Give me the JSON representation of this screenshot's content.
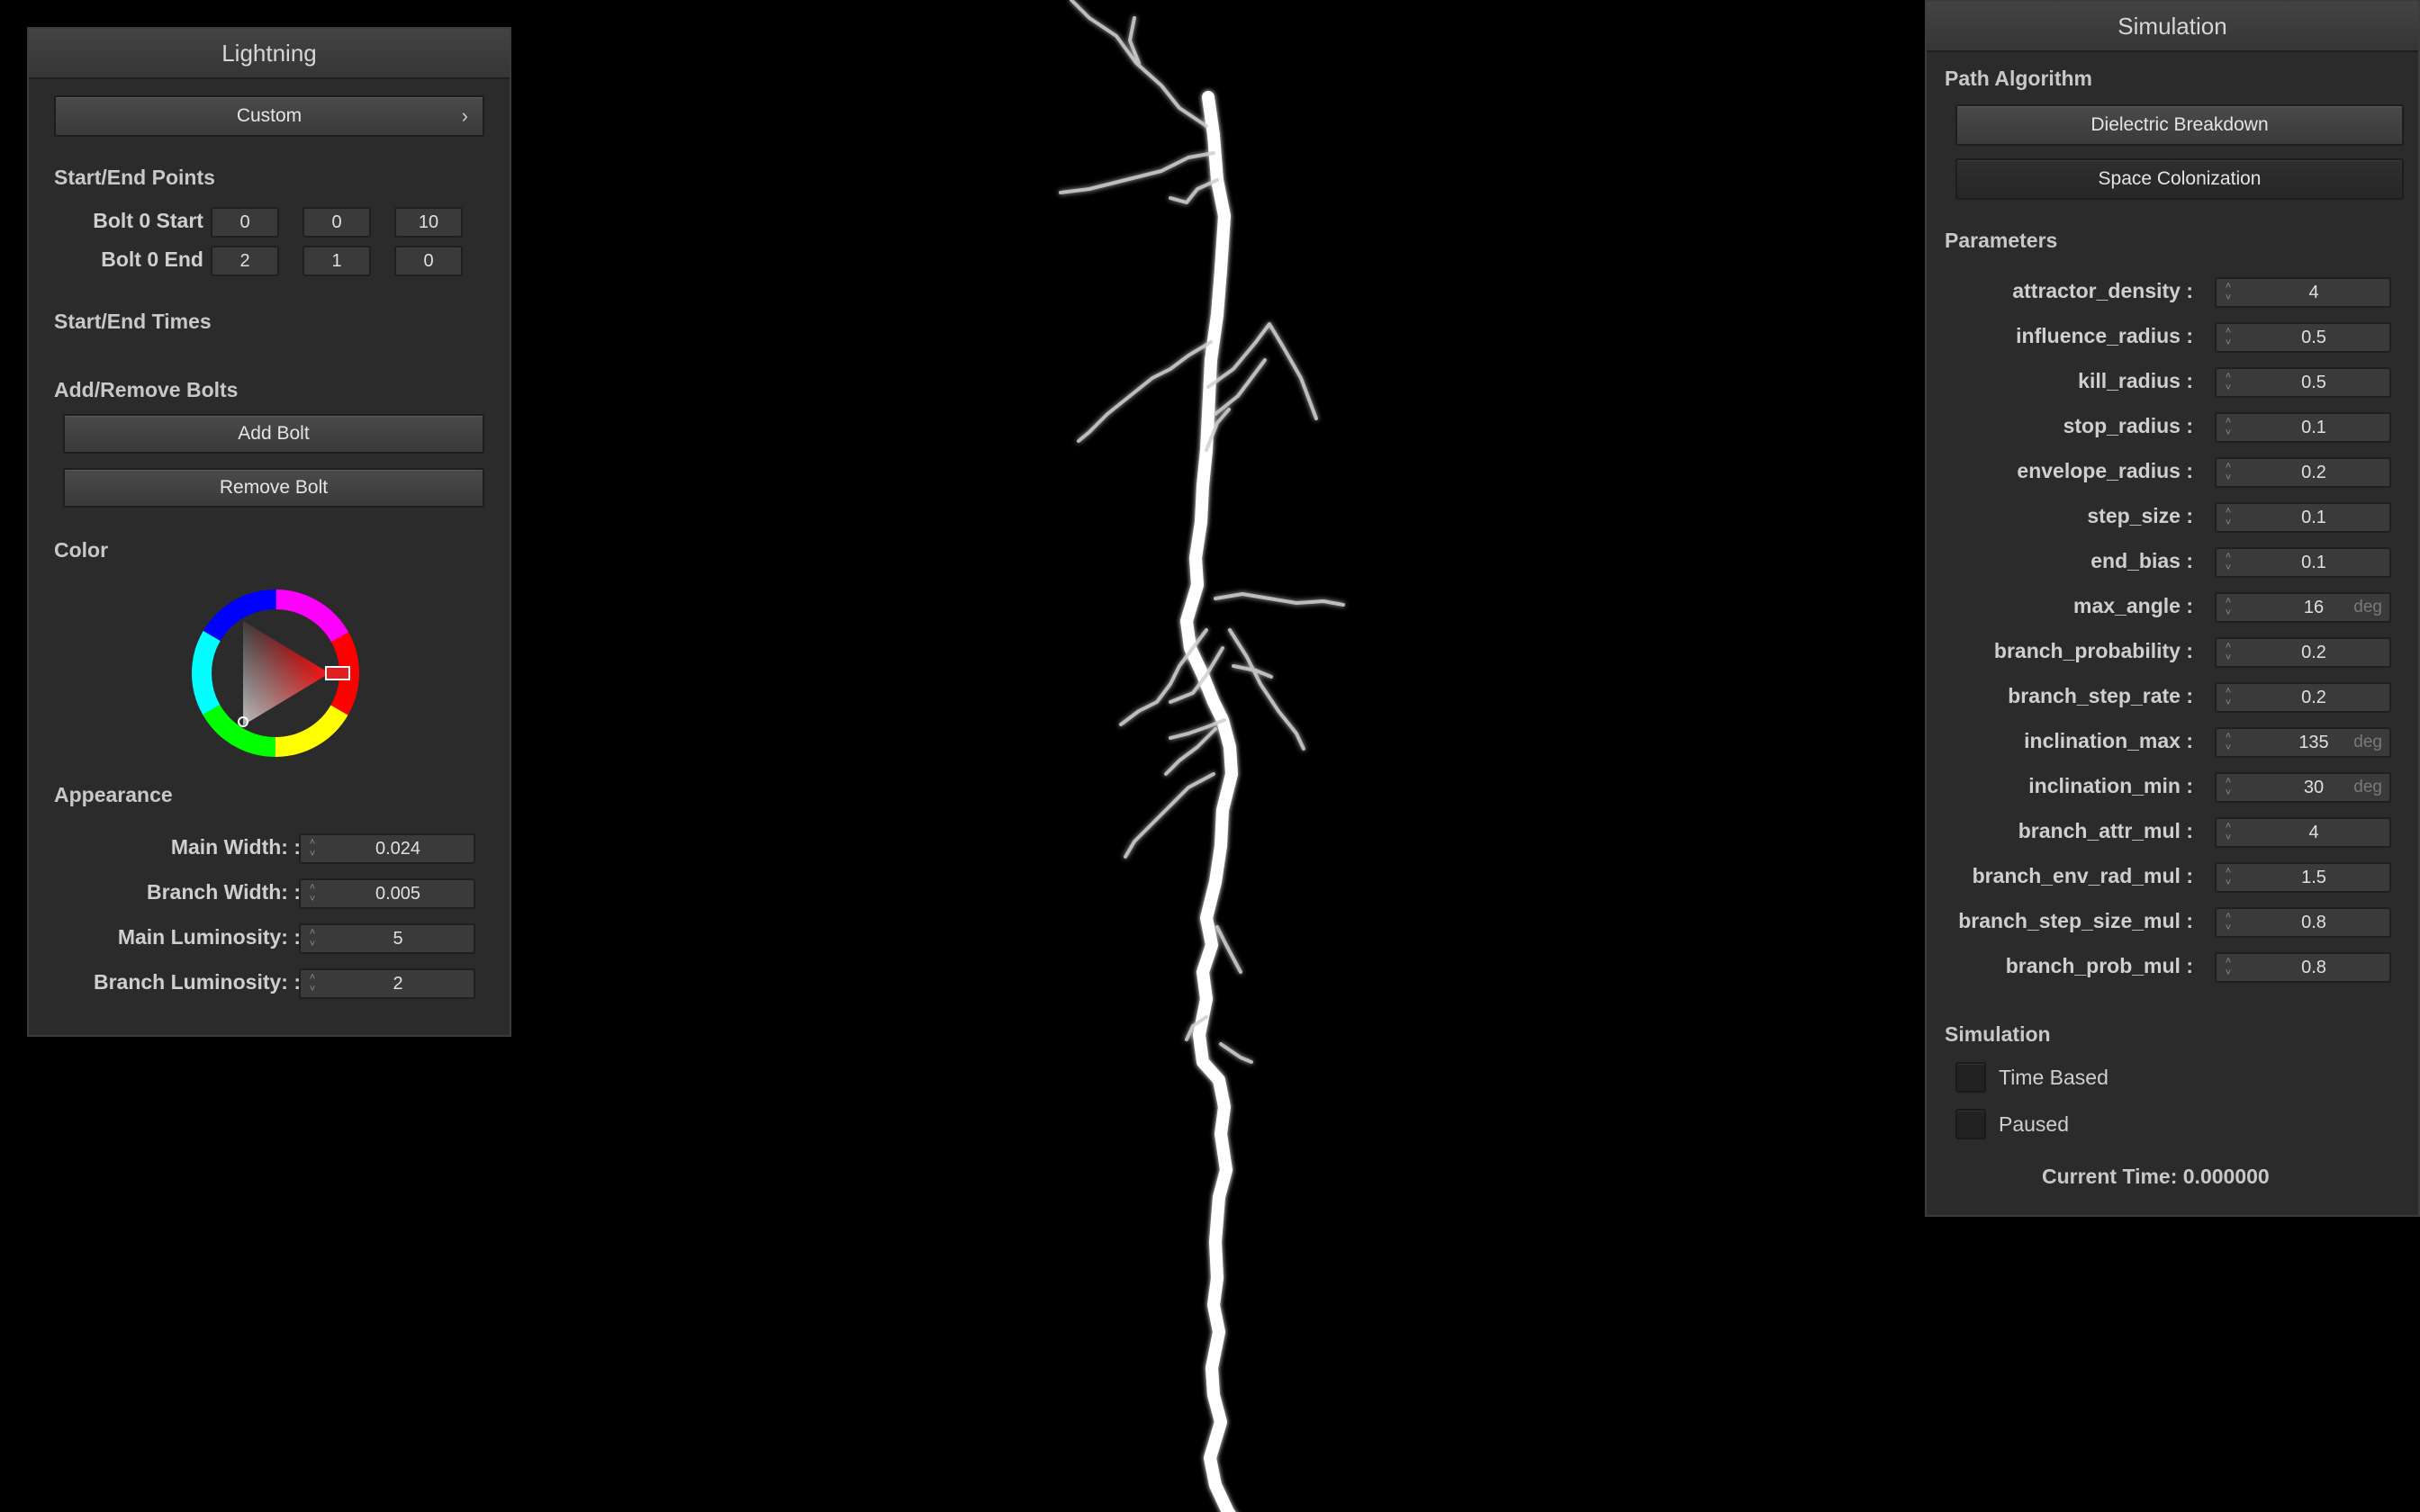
{
  "lightning_panel": {
    "title": "Lightning",
    "preset_button": "Custom",
    "preset_chevron": "›",
    "start_end_points": {
      "heading": "Start/End Points",
      "bolt_start_label": "Bolt 0 Start :",
      "bolt_start": [
        "0",
        "0",
        "10"
      ],
      "bolt_end_label": "Bolt 0 End :",
      "bolt_end": [
        "2",
        "1",
        "0"
      ]
    },
    "start_end_times": {
      "heading": "Start/End Times"
    },
    "add_remove": {
      "heading": "Add/Remove Bolts",
      "add_label": "Add Bolt",
      "remove_label": "Remove Bolt"
    },
    "color": {
      "heading": "Color",
      "selected_hue": "#ff0000"
    },
    "appearance": {
      "heading": "Appearance",
      "fields": [
        {
          "label": "Main Width: :",
          "value": "0.024"
        },
        {
          "label": "Branch Width: :",
          "value": "0.005"
        },
        {
          "label": "Main Luminosity: :",
          "value": "5"
        },
        {
          "label": "Branch Luminosity: :",
          "value": "2"
        }
      ]
    }
  },
  "simulation_panel": {
    "title": "Simulation",
    "path_algorithm": {
      "heading": "Path Algorithm",
      "options": [
        "Dielectric Breakdown",
        "Space Colonization"
      ]
    },
    "parameters": {
      "heading": "Parameters",
      "fields": [
        {
          "label": "attractor_density :",
          "value": "4",
          "unit": ""
        },
        {
          "label": "influence_radius :",
          "value": "0.5",
          "unit": ""
        },
        {
          "label": "kill_radius :",
          "value": "0.5",
          "unit": ""
        },
        {
          "label": "stop_radius :",
          "value": "0.1",
          "unit": ""
        },
        {
          "label": "envelope_radius :",
          "value": "0.2",
          "unit": ""
        },
        {
          "label": "step_size :",
          "value": "0.1",
          "unit": ""
        },
        {
          "label": "end_bias :",
          "value": "0.1",
          "unit": ""
        },
        {
          "label": "max_angle :",
          "value": "16",
          "unit": "deg"
        },
        {
          "label": "branch_probability :",
          "value": "0.2",
          "unit": ""
        },
        {
          "label": "branch_step_rate :",
          "value": "0.2",
          "unit": ""
        },
        {
          "label": "inclination_max :",
          "value": "135",
          "unit": "deg"
        },
        {
          "label": "inclination_min :",
          "value": "30",
          "unit": "deg"
        },
        {
          "label": "branch_attr_mul :",
          "value": "4",
          "unit": ""
        },
        {
          "label": "branch_env_rad_mul :",
          "value": "1.5",
          "unit": ""
        },
        {
          "label": "branch_step_size_mul :",
          "value": "0.8",
          "unit": ""
        },
        {
          "label": "branch_prob_mul :",
          "value": "0.8",
          "unit": ""
        }
      ]
    },
    "simulation": {
      "heading": "Simulation",
      "time_based_label": "Time Based",
      "time_based": false,
      "paused_label": "Paused",
      "paused": false,
      "current_time": "Current Time: 0.000000"
    }
  },
  "colors": {
    "panel_bg": "#2b2b2b",
    "viewport_bg": "#000000",
    "bolt": "#ffffff"
  }
}
